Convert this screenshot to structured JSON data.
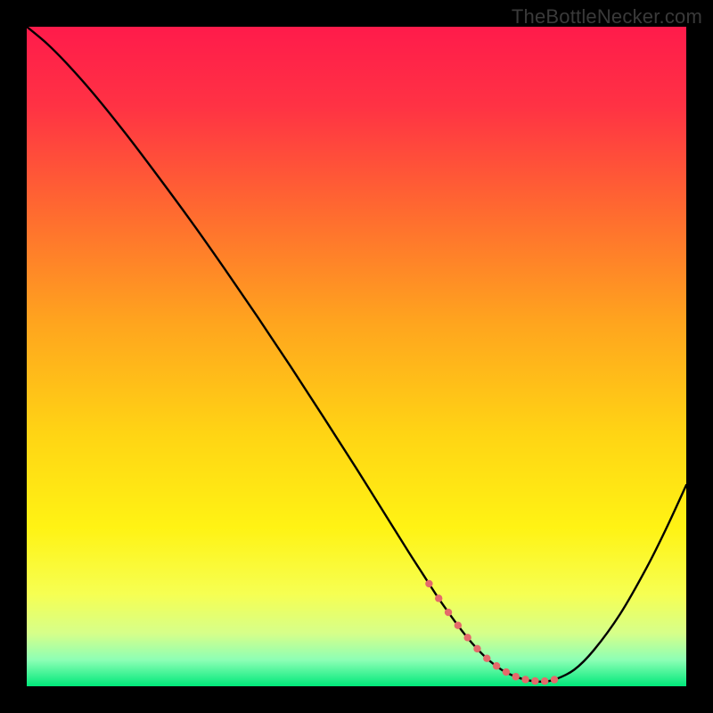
{
  "watermark": "TheBottleNecker.com",
  "colors": {
    "curve": "#000000",
    "dot": "#e46a6a",
    "background_top": "#ff1b4b",
    "background_bottom": "#00e87a"
  },
  "chart_data": {
    "type": "line",
    "title": "",
    "xlabel": "",
    "ylabel": "",
    "xlim": [
      0,
      100
    ],
    "ylim": [
      0,
      100
    ],
    "x": [
      0,
      3,
      6,
      10,
      15,
      20,
      25,
      30,
      35,
      40,
      45,
      50,
      55,
      58,
      60,
      62,
      64,
      66,
      68,
      70,
      72,
      74,
      76,
      78,
      80,
      83,
      86,
      90,
      94,
      97,
      100
    ],
    "values": [
      100,
      97.5,
      94.5,
      90.0,
      83.8,
      77.2,
      70.4,
      63.3,
      56.0,
      48.5,
      40.8,
      33.0,
      25.0,
      20.2,
      17.1,
      14.0,
      11.1,
      8.4,
      6.0,
      4.0,
      2.5,
      1.5,
      0.9,
      0.7,
      1.0,
      2.5,
      5.5,
      11.0,
      18.0,
      24.0,
      30.5
    ],
    "highlight_x_range": [
      61,
      80
    ],
    "highlight_y": 5.5,
    "highlight_dot_count": 14
  }
}
